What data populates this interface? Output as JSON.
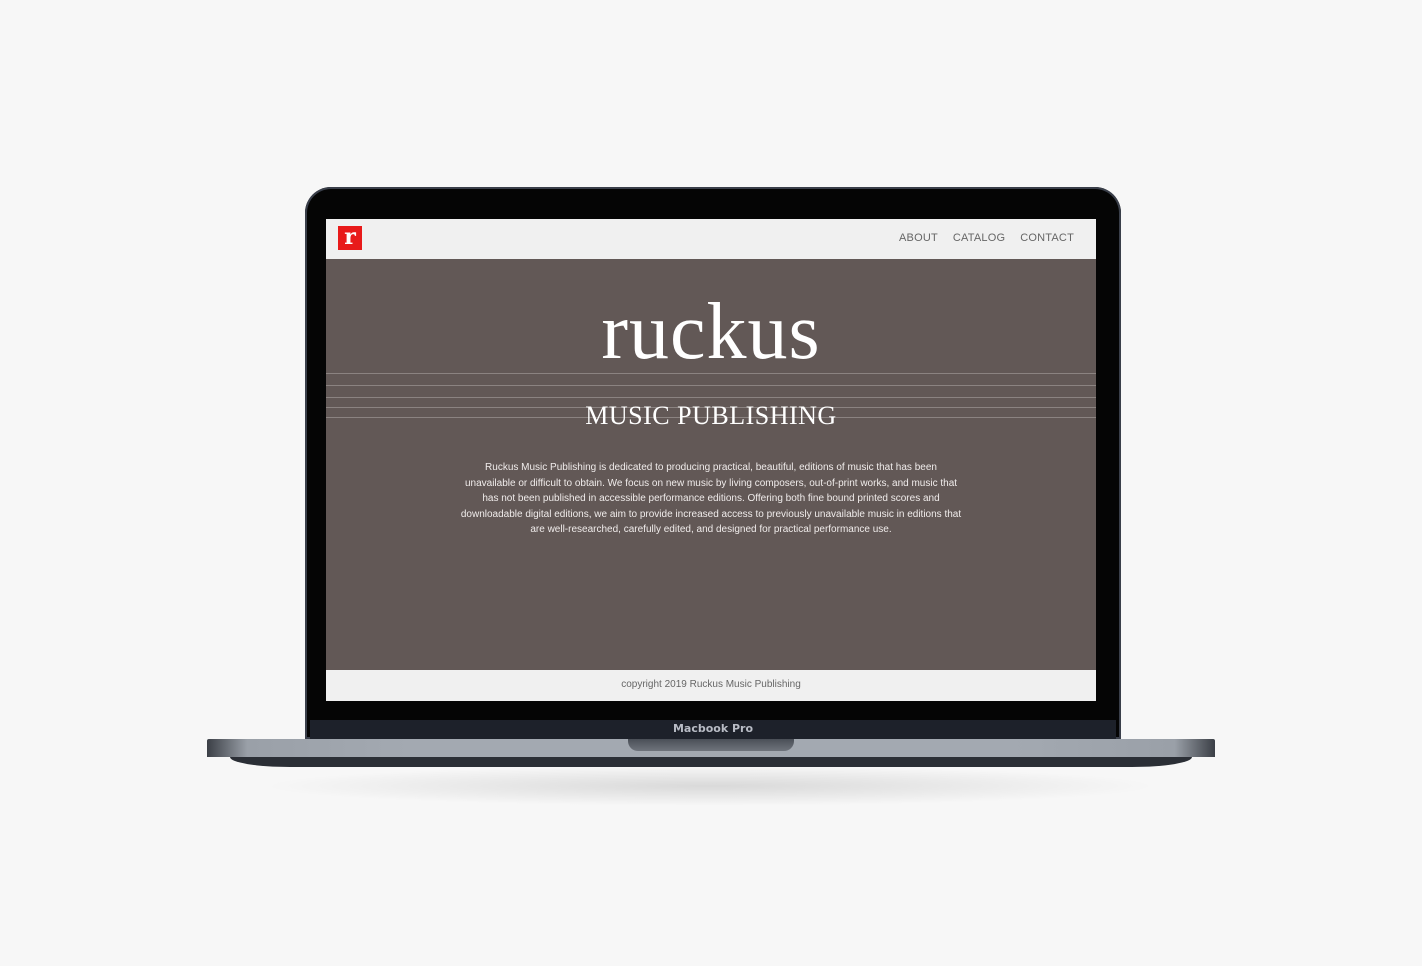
{
  "site": {
    "logo_letter": "r",
    "nav": [
      {
        "label": "ABOUT"
      },
      {
        "label": "CATALOG"
      },
      {
        "label": "CONTACT"
      }
    ],
    "brand_title": "ruckus",
    "brand_subtitle": "MUSIC PUBLISHING",
    "description": "Ruckus Music Publishing is dedicated to producing practical, beautiful, editions of music that has been unavailable or difficult to obtain. We focus on new music by living composers, out-of-print works, and music that has not been published in accessible performance editions. Offering both fine bound printed scores and downloadable digital editions, we aim to provide increased access to previously unavailable music in editions that are well-researched, carefully edited, and designed for practical performance use.",
    "footer": "copyright 2019 Ruckus Music Publishing"
  },
  "device": {
    "label": "Macbook Pro"
  },
  "colors": {
    "page_background": "#f7f7f7",
    "hero_background": "#625856",
    "nav_background": "#f0f0f0",
    "logo_red": "#e81a1a",
    "text_light": "#ffffff"
  },
  "icons": {
    "logo": "ruckus-r-logo-icon"
  }
}
